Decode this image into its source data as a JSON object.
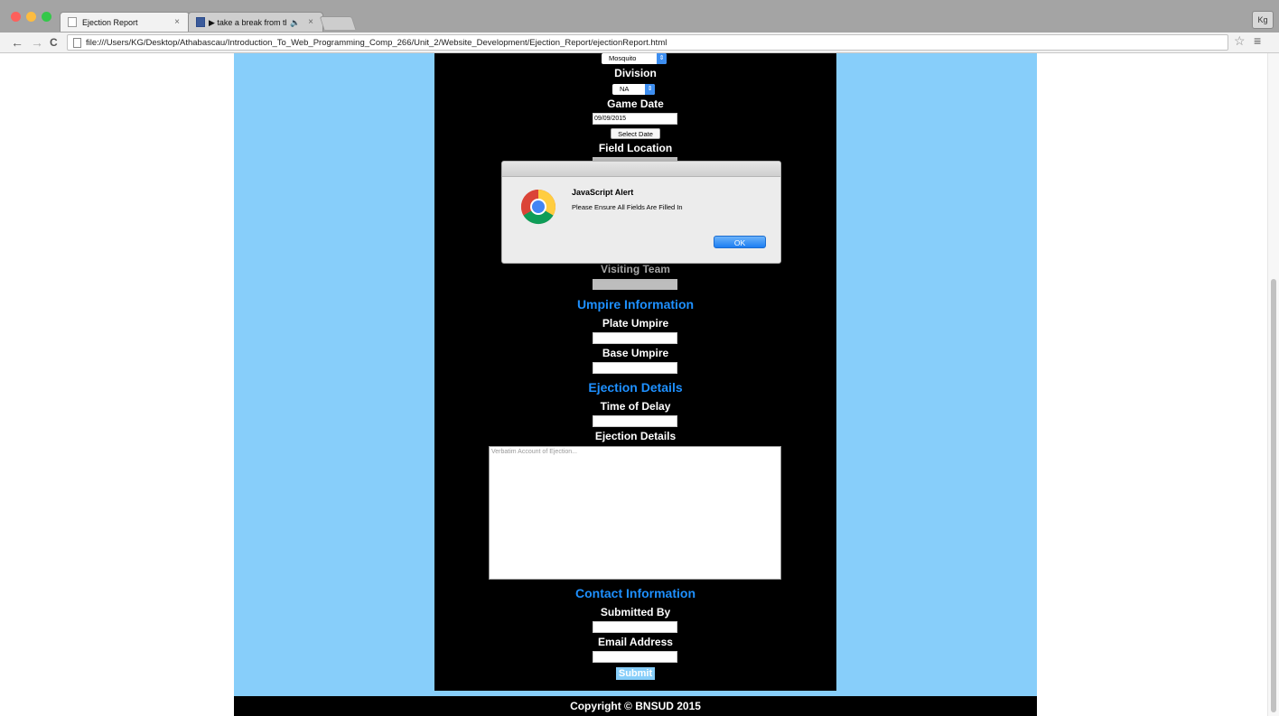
{
  "browser": {
    "tabs": [
      {
        "label": "Ejection Report",
        "close": "×"
      },
      {
        "label": "▶ take a break from this",
        "audio": "🔈",
        "close": "×"
      }
    ],
    "profile": "Kg",
    "url": "file:///Users/KG/Desktop/Athabascau/Introduction_To_Web_Programming_Comp_266/Unit_2/Website_Development/Ejection_Report/ejectionReport.html",
    "nav": {
      "back": "←",
      "forward": "→",
      "reload": "C"
    },
    "star": "☆",
    "menu": "≡"
  },
  "form": {
    "age_select": "Mosquito",
    "division_label": "Division",
    "division_select": "NA",
    "game_date_label": "Game Date",
    "game_date_value": "09/09/2015",
    "select_date_button": "Select Date",
    "field_location_label": "Field Location",
    "visiting_team_label": "Visiting Team",
    "umpire_section": "Umpire Information",
    "plate_umpire_label": "Plate Umpire",
    "base_umpire_label": "Base Umpire",
    "ejection_section": "Ejection Details",
    "time_of_delay_label": "Time of Delay",
    "ejection_details_label": "Ejection Details",
    "ejection_placeholder": "Verbatim Account of Ejection...",
    "contact_section": "Contact Information",
    "submitted_by_label": "Submitted By",
    "email_label": "Email Address",
    "submit_button": "Submit"
  },
  "footer": {
    "copyright": "Copyright © BNSUD 2015"
  },
  "alert": {
    "title": "JavaScript Alert",
    "message": "Please Ensure All Fields Are Filled In",
    "ok_button": "OK"
  },
  "colors": {
    "page_background": "#87cefa",
    "form_background": "#000000",
    "section_heading": "#1e90ff",
    "alert_button": "#1c7ef2"
  }
}
